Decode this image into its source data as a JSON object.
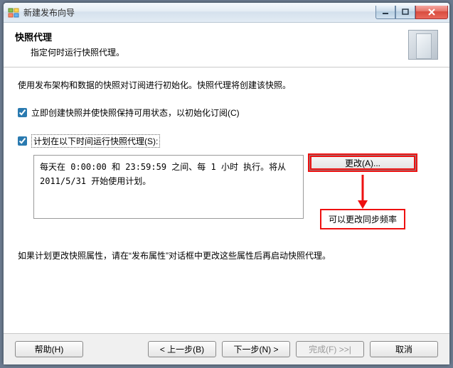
{
  "window": {
    "title": "新建发布向导"
  },
  "header": {
    "title": "快照代理",
    "subtitle": "指定何时运行快照代理。"
  },
  "body": {
    "intro": "使用发布架构和数据的快照对订阅进行初始化。快照代理将创建该快照。",
    "check1_label": "立即创建快照并使快照保持可用状态，以初始化订阅(C)",
    "check2_label": "计划在以下时间运行快照代理(S):",
    "schedule_text": "每天在 0:00:00 和 23:59:59 之间、每 1 小时 执行。将从 2011/5/31 开始使用计划。",
    "change_btn": "更改(A)...",
    "note": "可以更改同步频率",
    "footer_note": "如果计划更改快照属性，请在“发布属性”对话框中更改这些属性后再启动快照代理。"
  },
  "buttons": {
    "help": "帮助(H)",
    "back": "< 上一步(B)",
    "next": "下一步(N) >",
    "finish": "完成(F) >>|",
    "cancel": "取消"
  }
}
